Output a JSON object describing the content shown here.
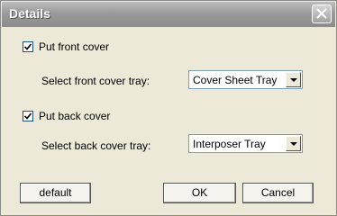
{
  "window": {
    "title": "Details",
    "close_icon": "close-icon"
  },
  "front": {
    "checkbox_label": "Put front cover",
    "checked": true,
    "tray_label": "Select front cover tray:",
    "tray_value": "Cover Sheet Tray"
  },
  "back": {
    "checkbox_label": "Put back cover",
    "checked": true,
    "tray_label": "Select back cover tray:",
    "tray_value": "Interposer Tray"
  },
  "buttons": {
    "default": "default",
    "ok": "OK",
    "cancel": "Cancel"
  },
  "colors": {
    "titlebar": "#9a9a9a",
    "dialog": "#ece9d8",
    "check": "#000000"
  }
}
